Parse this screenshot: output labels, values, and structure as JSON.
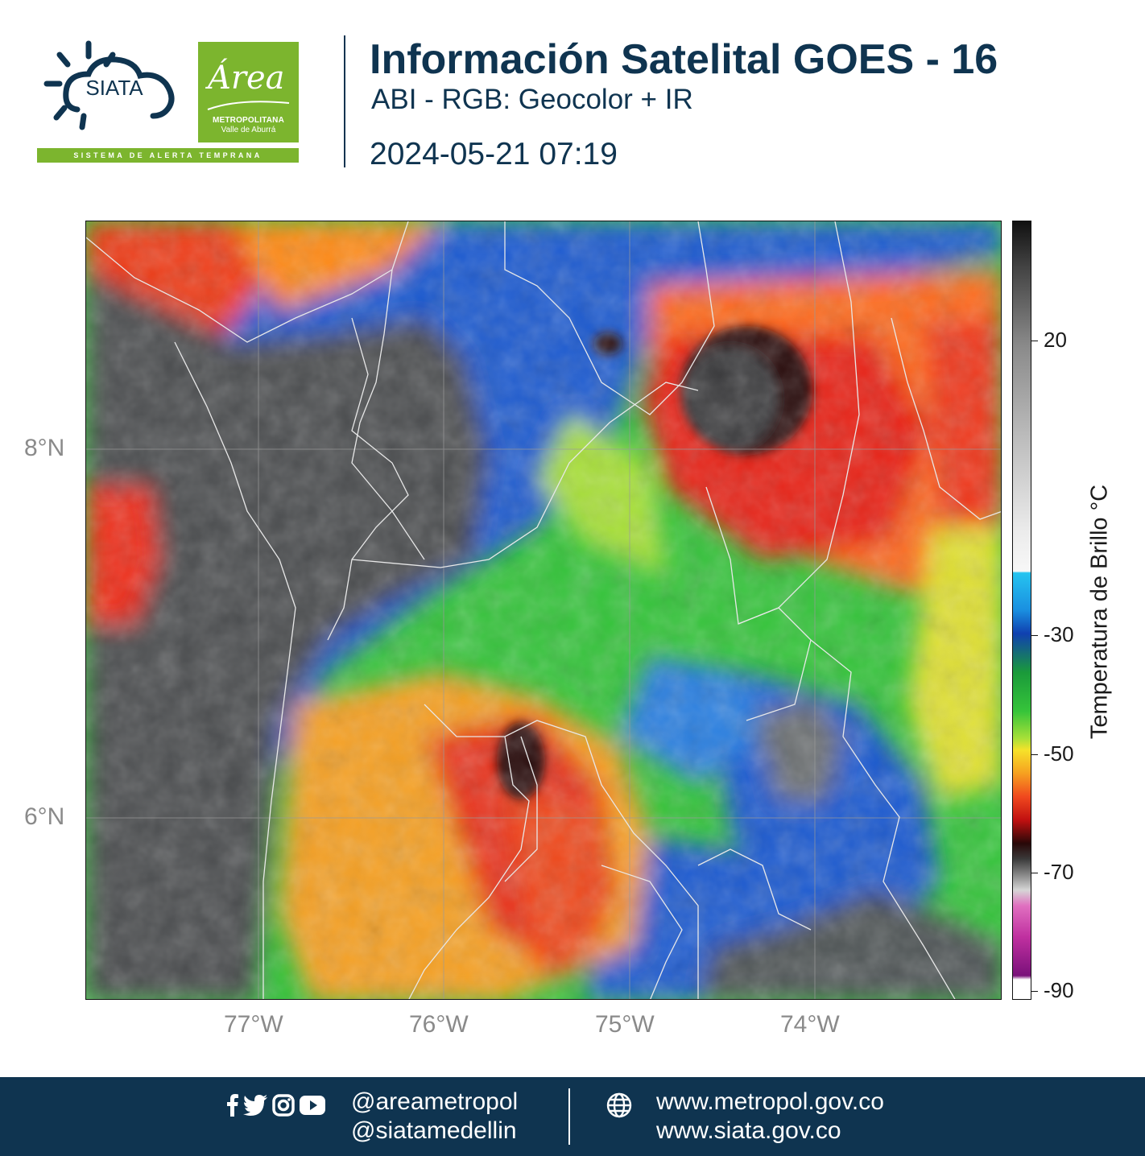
{
  "header": {
    "siata_logo_text": "SIATA",
    "area_logo_script": "Área",
    "area_logo_line1": "METROPOLITANA",
    "area_logo_line2": "Valle de Aburrá",
    "banner_text": "SISTEMA DE ALERTA TEMPRANA",
    "title": "Información Satelital GOES - 16",
    "subtitle": "ABI - RGB: Geocolor + IR",
    "timestamp": "2024-05-21 07:19"
  },
  "map": {
    "lat_labels": [
      "8°N",
      "6°N"
    ],
    "lon_labels": [
      "77°W",
      "76°W",
      "75°W",
      "74°W"
    ]
  },
  "colorbar": {
    "label": "Temperatura de Brillo °C",
    "ticks": [
      "20",
      "-30",
      "-50",
      "-70",
      "-90"
    ],
    "range": [
      -90,
      30
    ]
  },
  "footer": {
    "handle1": "@areametropol",
    "handle2": "@siatamedellin",
    "url1": "www.metropol.gov.co",
    "url2": "www.siata.gov.co",
    "social_icons": [
      "facebook-icon",
      "twitter-icon",
      "instagram-icon",
      "youtube-icon"
    ],
    "web_icon": "globe-icon"
  },
  "colors": {
    "navy": "#0f3450",
    "green": "#7cb52e"
  }
}
